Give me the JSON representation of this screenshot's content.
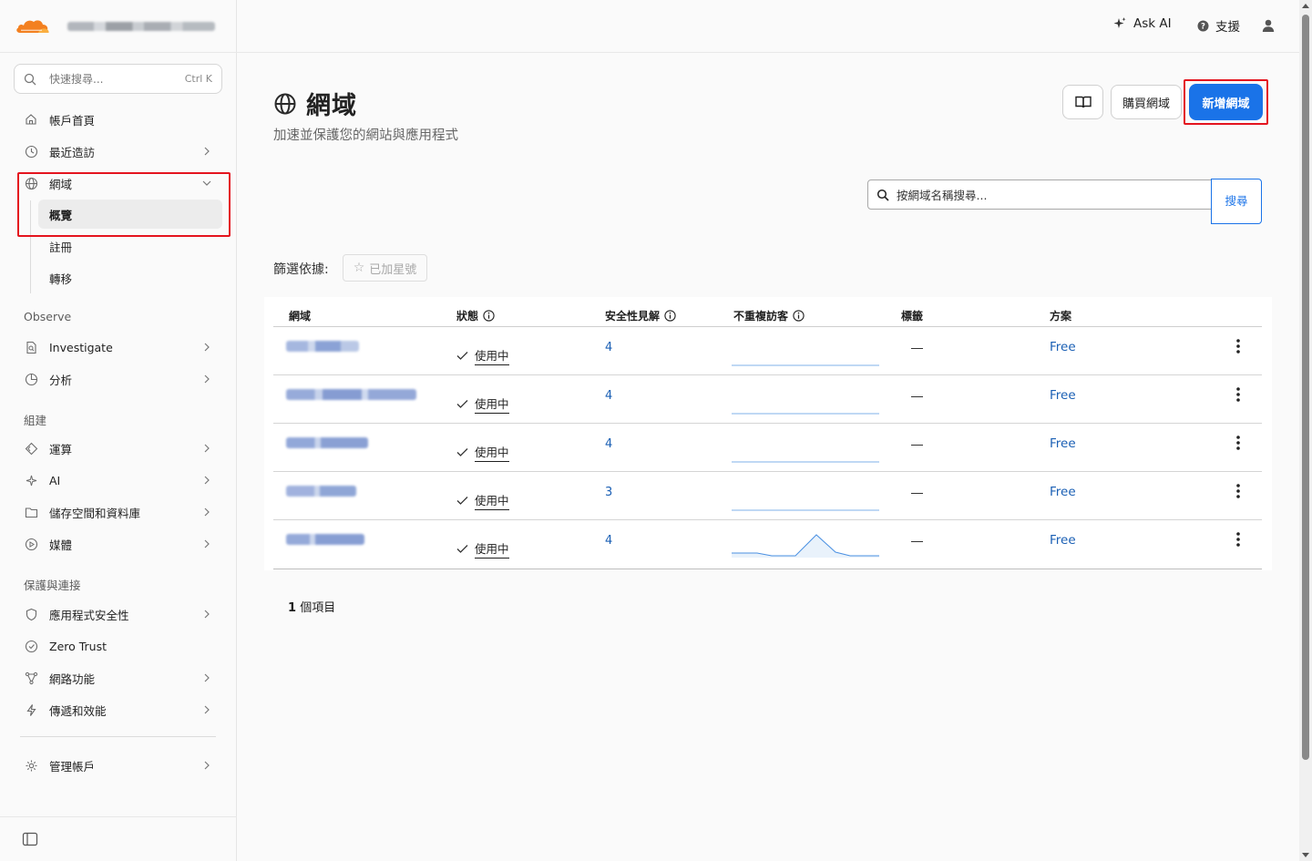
{
  "header": {
    "ask_ai": "Ask AI",
    "support": "支援"
  },
  "sidebar": {
    "search_placeholder": "快速搜尋...",
    "search_shortcut": "Ctrl K",
    "items": {
      "home": "帳戶首頁",
      "recent": "最近造訪",
      "domains": "網域",
      "overview": "概覽",
      "register": "註冊",
      "transfer": "轉移",
      "investigate": "Investigate",
      "analytics": "分析",
      "compute": "運算",
      "ai": "AI",
      "storage": "儲存空間和資料庫",
      "media": "媒體",
      "app_security": "應用程式安全性",
      "zero_trust": "Zero Trust",
      "networking": "網路功能",
      "delivery": "傳遞和效能",
      "manage_account": "管理帳戶"
    },
    "sections": {
      "observe": "Observe",
      "build": "組建",
      "protect": "保護與連接"
    }
  },
  "main": {
    "title": "網域",
    "subtitle": "加速並保護您的網站與應用程式",
    "buy_domain": "購買網域",
    "add_domain": "新增網域",
    "domain_search_placeholder": "按網域名稱搜尋...",
    "search_button": "搜尋",
    "filter_label": "篩選依據:",
    "filter_starred": "已加星號",
    "columns": {
      "domain": "網域",
      "status": "狀態",
      "security": "安全性見解",
      "visitors": "不重複訪客",
      "tags": "標籤",
      "plan": "方案"
    },
    "rows": [
      {
        "status": "使用中",
        "security": "4",
        "tags": "—",
        "plan": "Free"
      },
      {
        "status": "使用中",
        "security": "4",
        "tags": "—",
        "plan": "Free"
      },
      {
        "status": "使用中",
        "security": "4",
        "tags": "—",
        "plan": "Free"
      },
      {
        "status": "使用中",
        "security": "3",
        "tags": "—",
        "plan": "Free"
      },
      {
        "status": "使用中",
        "security": "4",
        "tags": "—",
        "plan": "Free"
      }
    ],
    "count_number": "1",
    "count_label": "個項目"
  },
  "colors": {
    "accent": "#1a73e8",
    "link": "#1a5fb4",
    "highlight": "#e4141e",
    "brand_orange": "#f38020"
  }
}
